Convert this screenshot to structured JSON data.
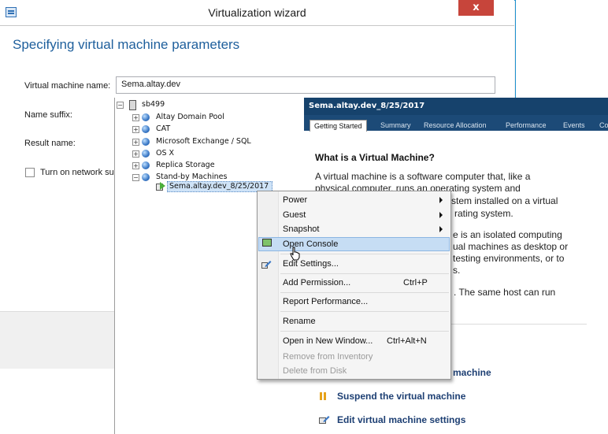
{
  "window": {
    "title": "Virtualization wizard",
    "close_label": "x"
  },
  "wizard": {
    "heading": "Specifying virtual machine parameters",
    "vm_name_label": "Virtual machine name:",
    "vm_name_value": "Sema.altay.dev",
    "name_suffix_label": "Name suffix:",
    "result_name_label": "Result name:",
    "network_checkbox_label": "Turn on network su"
  },
  "tree": {
    "root": "sb499",
    "items": [
      "Altay Domain Pool",
      "CAT",
      "Microsoft Exchange / SQL",
      "OS X",
      "Replica Storage",
      "Stand-by Machines"
    ],
    "selected_vm": "Sema.altay.dev_8/25/2017"
  },
  "detail": {
    "title": "Sema.altay.dev_8/25/2017",
    "tabs": [
      "Getting Started",
      "Summary",
      "Resource Allocation",
      "Performance",
      "Events",
      "Co"
    ],
    "what_title": "What is a Virtual Machine?",
    "para1": [
      "A virtual machine is a software computer that, like a",
      "physical computer, runs an operating system and",
      "stem installed on a virtual",
      "rating system."
    ],
    "para2": [
      "e is an isolated computing",
      "ual machines as desktop or",
      "testing environments, or to",
      "s."
    ],
    "para3": ". The same host can run",
    "actions": {
      "power_partial": "machine",
      "suspend": "Suspend the virtual machine",
      "edit": "Edit virtual machine settings"
    }
  },
  "context_menu": {
    "power": "Power",
    "guest": "Guest",
    "snapshot": "Snapshot",
    "open_console": "Open Console",
    "edit_settings": "Edit Settings...",
    "add_permission": "Add Permission...",
    "add_permission_shortcut": "Ctrl+P",
    "report_performance": "Report Performance...",
    "rename": "Rename",
    "open_new_window": "Open in New Window...",
    "open_new_window_shortcut": "Ctrl+Alt+N",
    "remove_inventory": "Remove from Inventory",
    "delete_disk": "Delete from Disk"
  },
  "colors": {
    "accent": "#1e5f9c",
    "detail_header": "#16426c",
    "close": "#c7453b",
    "menu_highlight": "#c6ddf4"
  }
}
